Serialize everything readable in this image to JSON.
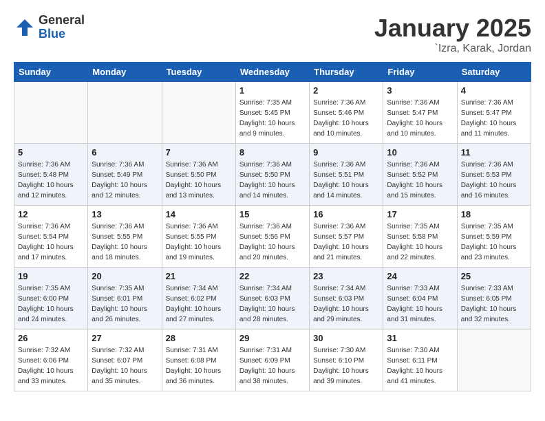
{
  "header": {
    "logo_general": "General",
    "logo_blue": "Blue",
    "month_title": "January 2025",
    "location": "`Izra, Karak, Jordan"
  },
  "days_of_week": [
    "Sunday",
    "Monday",
    "Tuesday",
    "Wednesday",
    "Thursday",
    "Friday",
    "Saturday"
  ],
  "weeks": [
    [
      {
        "day": "",
        "info": ""
      },
      {
        "day": "",
        "info": ""
      },
      {
        "day": "",
        "info": ""
      },
      {
        "day": "1",
        "info": "Sunrise: 7:35 AM\nSunset: 5:45 PM\nDaylight: 10 hours\nand 9 minutes."
      },
      {
        "day": "2",
        "info": "Sunrise: 7:36 AM\nSunset: 5:46 PM\nDaylight: 10 hours\nand 10 minutes."
      },
      {
        "day": "3",
        "info": "Sunrise: 7:36 AM\nSunset: 5:47 PM\nDaylight: 10 hours\nand 10 minutes."
      },
      {
        "day": "4",
        "info": "Sunrise: 7:36 AM\nSunset: 5:47 PM\nDaylight: 10 hours\nand 11 minutes."
      }
    ],
    [
      {
        "day": "5",
        "info": "Sunrise: 7:36 AM\nSunset: 5:48 PM\nDaylight: 10 hours\nand 12 minutes."
      },
      {
        "day": "6",
        "info": "Sunrise: 7:36 AM\nSunset: 5:49 PM\nDaylight: 10 hours\nand 12 minutes."
      },
      {
        "day": "7",
        "info": "Sunrise: 7:36 AM\nSunset: 5:50 PM\nDaylight: 10 hours\nand 13 minutes."
      },
      {
        "day": "8",
        "info": "Sunrise: 7:36 AM\nSunset: 5:50 PM\nDaylight: 10 hours\nand 14 minutes."
      },
      {
        "day": "9",
        "info": "Sunrise: 7:36 AM\nSunset: 5:51 PM\nDaylight: 10 hours\nand 14 minutes."
      },
      {
        "day": "10",
        "info": "Sunrise: 7:36 AM\nSunset: 5:52 PM\nDaylight: 10 hours\nand 15 minutes."
      },
      {
        "day": "11",
        "info": "Sunrise: 7:36 AM\nSunset: 5:53 PM\nDaylight: 10 hours\nand 16 minutes."
      }
    ],
    [
      {
        "day": "12",
        "info": "Sunrise: 7:36 AM\nSunset: 5:54 PM\nDaylight: 10 hours\nand 17 minutes."
      },
      {
        "day": "13",
        "info": "Sunrise: 7:36 AM\nSunset: 5:55 PM\nDaylight: 10 hours\nand 18 minutes."
      },
      {
        "day": "14",
        "info": "Sunrise: 7:36 AM\nSunset: 5:55 PM\nDaylight: 10 hours\nand 19 minutes."
      },
      {
        "day": "15",
        "info": "Sunrise: 7:36 AM\nSunset: 5:56 PM\nDaylight: 10 hours\nand 20 minutes."
      },
      {
        "day": "16",
        "info": "Sunrise: 7:36 AM\nSunset: 5:57 PM\nDaylight: 10 hours\nand 21 minutes."
      },
      {
        "day": "17",
        "info": "Sunrise: 7:35 AM\nSunset: 5:58 PM\nDaylight: 10 hours\nand 22 minutes."
      },
      {
        "day": "18",
        "info": "Sunrise: 7:35 AM\nSunset: 5:59 PM\nDaylight: 10 hours\nand 23 minutes."
      }
    ],
    [
      {
        "day": "19",
        "info": "Sunrise: 7:35 AM\nSunset: 6:00 PM\nDaylight: 10 hours\nand 24 minutes."
      },
      {
        "day": "20",
        "info": "Sunrise: 7:35 AM\nSunset: 6:01 PM\nDaylight: 10 hours\nand 26 minutes."
      },
      {
        "day": "21",
        "info": "Sunrise: 7:34 AM\nSunset: 6:02 PM\nDaylight: 10 hours\nand 27 minutes."
      },
      {
        "day": "22",
        "info": "Sunrise: 7:34 AM\nSunset: 6:03 PM\nDaylight: 10 hours\nand 28 minutes."
      },
      {
        "day": "23",
        "info": "Sunrise: 7:34 AM\nSunset: 6:03 PM\nDaylight: 10 hours\nand 29 minutes."
      },
      {
        "day": "24",
        "info": "Sunrise: 7:33 AM\nSunset: 6:04 PM\nDaylight: 10 hours\nand 31 minutes."
      },
      {
        "day": "25",
        "info": "Sunrise: 7:33 AM\nSunset: 6:05 PM\nDaylight: 10 hours\nand 32 minutes."
      }
    ],
    [
      {
        "day": "26",
        "info": "Sunrise: 7:32 AM\nSunset: 6:06 PM\nDaylight: 10 hours\nand 33 minutes."
      },
      {
        "day": "27",
        "info": "Sunrise: 7:32 AM\nSunset: 6:07 PM\nDaylight: 10 hours\nand 35 minutes."
      },
      {
        "day": "28",
        "info": "Sunrise: 7:31 AM\nSunset: 6:08 PM\nDaylight: 10 hours\nand 36 minutes."
      },
      {
        "day": "29",
        "info": "Sunrise: 7:31 AM\nSunset: 6:09 PM\nDaylight: 10 hours\nand 38 minutes."
      },
      {
        "day": "30",
        "info": "Sunrise: 7:30 AM\nSunset: 6:10 PM\nDaylight: 10 hours\nand 39 minutes."
      },
      {
        "day": "31",
        "info": "Sunrise: 7:30 AM\nSunset: 6:11 PM\nDaylight: 10 hours\nand 41 minutes."
      },
      {
        "day": "",
        "info": ""
      }
    ]
  ]
}
